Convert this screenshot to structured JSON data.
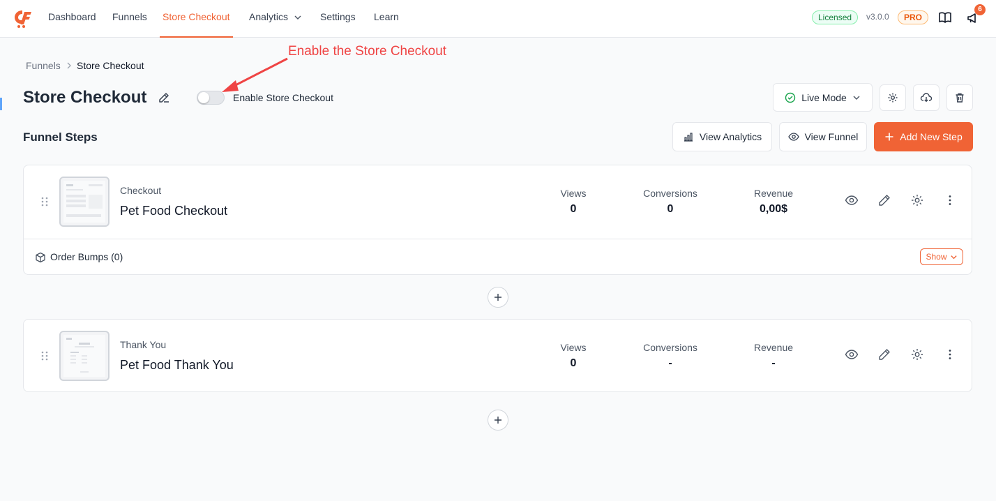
{
  "nav": {
    "items": [
      {
        "label": "Dashboard"
      },
      {
        "label": "Funnels"
      },
      {
        "label": "Store Checkout"
      },
      {
        "label": "Analytics"
      },
      {
        "label": "Settings"
      },
      {
        "label": "Learn"
      }
    ],
    "active_index": 2,
    "licensed": "Licensed",
    "version": "v3.0.0",
    "pro": "PRO",
    "notifications": "6"
  },
  "breadcrumb": {
    "parent": "Funnels",
    "current": "Store Checkout"
  },
  "header": {
    "title": "Store Checkout",
    "toggle_label": "Enable Store Checkout",
    "toggle_on": false,
    "mode_label": "Live Mode"
  },
  "annotation": {
    "text": "Enable the Store Checkout"
  },
  "steps_section": {
    "title": "Funnel Steps",
    "view_analytics": "View Analytics",
    "view_funnel": "View Funnel",
    "add_step": "Add New Step"
  },
  "steps": [
    {
      "type": "Checkout",
      "name": "Pet Food Checkout",
      "views_label": "Views",
      "views": "0",
      "conversions_label": "Conversions",
      "conversions": "0",
      "revenue_label": "Revenue",
      "revenue": "0,00$",
      "order_bumps": "Order Bumps (0)",
      "show_label": "Show"
    },
    {
      "type": "Thank You",
      "name": "Pet Food Thank You",
      "views_label": "Views",
      "views": "0",
      "conversions_label": "Conversions",
      "conversions": "-",
      "revenue_label": "Revenue",
      "revenue": "-"
    }
  ],
  "colors": {
    "accent": "#f06335",
    "success": "#16a34a",
    "annotation": "#ef4444"
  }
}
